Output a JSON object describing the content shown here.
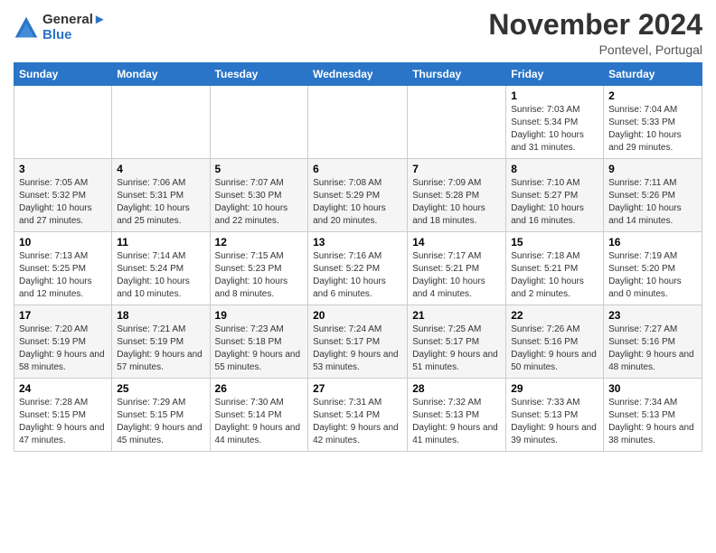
{
  "header": {
    "logo_line1": "General",
    "logo_line2": "Blue",
    "month_title": "November 2024",
    "location": "Pontevel, Portugal"
  },
  "days_of_week": [
    "Sunday",
    "Monday",
    "Tuesday",
    "Wednesday",
    "Thursday",
    "Friday",
    "Saturday"
  ],
  "weeks": [
    [
      {
        "day": "",
        "info": ""
      },
      {
        "day": "",
        "info": ""
      },
      {
        "day": "",
        "info": ""
      },
      {
        "day": "",
        "info": ""
      },
      {
        "day": "",
        "info": ""
      },
      {
        "day": "1",
        "info": "Sunrise: 7:03 AM\nSunset: 5:34 PM\nDaylight: 10 hours and 31 minutes."
      },
      {
        "day": "2",
        "info": "Sunrise: 7:04 AM\nSunset: 5:33 PM\nDaylight: 10 hours and 29 minutes."
      }
    ],
    [
      {
        "day": "3",
        "info": "Sunrise: 7:05 AM\nSunset: 5:32 PM\nDaylight: 10 hours and 27 minutes."
      },
      {
        "day": "4",
        "info": "Sunrise: 7:06 AM\nSunset: 5:31 PM\nDaylight: 10 hours and 25 minutes."
      },
      {
        "day": "5",
        "info": "Sunrise: 7:07 AM\nSunset: 5:30 PM\nDaylight: 10 hours and 22 minutes."
      },
      {
        "day": "6",
        "info": "Sunrise: 7:08 AM\nSunset: 5:29 PM\nDaylight: 10 hours and 20 minutes."
      },
      {
        "day": "7",
        "info": "Sunrise: 7:09 AM\nSunset: 5:28 PM\nDaylight: 10 hours and 18 minutes."
      },
      {
        "day": "8",
        "info": "Sunrise: 7:10 AM\nSunset: 5:27 PM\nDaylight: 10 hours and 16 minutes."
      },
      {
        "day": "9",
        "info": "Sunrise: 7:11 AM\nSunset: 5:26 PM\nDaylight: 10 hours and 14 minutes."
      }
    ],
    [
      {
        "day": "10",
        "info": "Sunrise: 7:13 AM\nSunset: 5:25 PM\nDaylight: 10 hours and 12 minutes."
      },
      {
        "day": "11",
        "info": "Sunrise: 7:14 AM\nSunset: 5:24 PM\nDaylight: 10 hours and 10 minutes."
      },
      {
        "day": "12",
        "info": "Sunrise: 7:15 AM\nSunset: 5:23 PM\nDaylight: 10 hours and 8 minutes."
      },
      {
        "day": "13",
        "info": "Sunrise: 7:16 AM\nSunset: 5:22 PM\nDaylight: 10 hours and 6 minutes."
      },
      {
        "day": "14",
        "info": "Sunrise: 7:17 AM\nSunset: 5:21 PM\nDaylight: 10 hours and 4 minutes."
      },
      {
        "day": "15",
        "info": "Sunrise: 7:18 AM\nSunset: 5:21 PM\nDaylight: 10 hours and 2 minutes."
      },
      {
        "day": "16",
        "info": "Sunrise: 7:19 AM\nSunset: 5:20 PM\nDaylight: 10 hours and 0 minutes."
      }
    ],
    [
      {
        "day": "17",
        "info": "Sunrise: 7:20 AM\nSunset: 5:19 PM\nDaylight: 9 hours and 58 minutes."
      },
      {
        "day": "18",
        "info": "Sunrise: 7:21 AM\nSunset: 5:19 PM\nDaylight: 9 hours and 57 minutes."
      },
      {
        "day": "19",
        "info": "Sunrise: 7:23 AM\nSunset: 5:18 PM\nDaylight: 9 hours and 55 minutes."
      },
      {
        "day": "20",
        "info": "Sunrise: 7:24 AM\nSunset: 5:17 PM\nDaylight: 9 hours and 53 minutes."
      },
      {
        "day": "21",
        "info": "Sunrise: 7:25 AM\nSunset: 5:17 PM\nDaylight: 9 hours and 51 minutes."
      },
      {
        "day": "22",
        "info": "Sunrise: 7:26 AM\nSunset: 5:16 PM\nDaylight: 9 hours and 50 minutes."
      },
      {
        "day": "23",
        "info": "Sunrise: 7:27 AM\nSunset: 5:16 PM\nDaylight: 9 hours and 48 minutes."
      }
    ],
    [
      {
        "day": "24",
        "info": "Sunrise: 7:28 AM\nSunset: 5:15 PM\nDaylight: 9 hours and 47 minutes."
      },
      {
        "day": "25",
        "info": "Sunrise: 7:29 AM\nSunset: 5:15 PM\nDaylight: 9 hours and 45 minutes."
      },
      {
        "day": "26",
        "info": "Sunrise: 7:30 AM\nSunset: 5:14 PM\nDaylight: 9 hours and 44 minutes."
      },
      {
        "day": "27",
        "info": "Sunrise: 7:31 AM\nSunset: 5:14 PM\nDaylight: 9 hours and 42 minutes."
      },
      {
        "day": "28",
        "info": "Sunrise: 7:32 AM\nSunset: 5:13 PM\nDaylight: 9 hours and 41 minutes."
      },
      {
        "day": "29",
        "info": "Sunrise: 7:33 AM\nSunset: 5:13 PM\nDaylight: 9 hours and 39 minutes."
      },
      {
        "day": "30",
        "info": "Sunrise: 7:34 AM\nSunset: 5:13 PM\nDaylight: 9 hours and 38 minutes."
      }
    ]
  ]
}
